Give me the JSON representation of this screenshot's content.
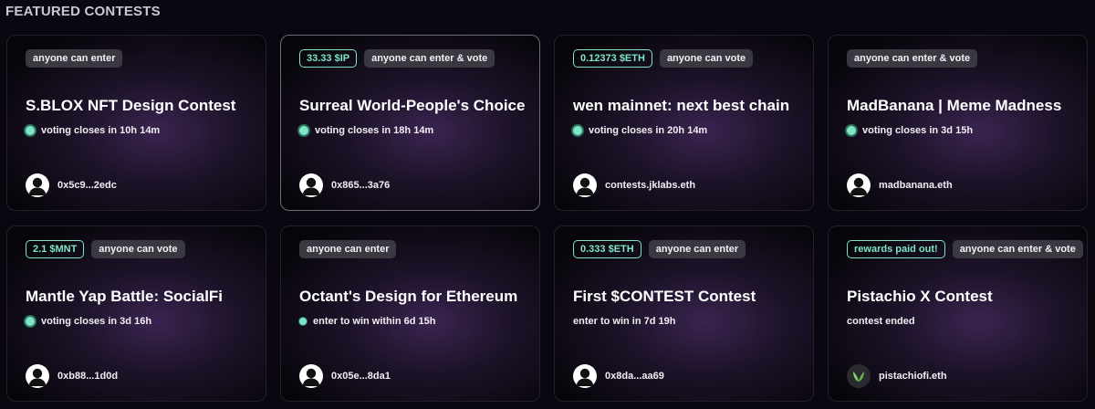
{
  "section_title": "FEATURED CONTESTS",
  "colors": {
    "accent": "#7ee6c4",
    "badge_bg": "#3a3840",
    "card_glow": "#3a2450"
  },
  "contests": [
    {
      "badges": [
        {
          "label": "anyone can enter",
          "kind": "plain"
        }
      ],
      "title": "S.BLOX NFT Design Contest",
      "status": "voting closes in 10h 14m",
      "status_dot": "large",
      "author": "0x5c9...2edc",
      "avatar": "user-avatar-icon"
    },
    {
      "badges": [
        {
          "label": "33.33 $IP",
          "kind": "reward"
        },
        {
          "label": "anyone can enter & vote",
          "kind": "plain"
        }
      ],
      "title": "Surreal World-People's Choice",
      "status": "voting closes in 18h 14m",
      "status_dot": "large",
      "author": "0x865...3a76",
      "avatar": "user-avatar-icon"
    },
    {
      "badges": [
        {
          "label": "0.12373 $ETH",
          "kind": "reward"
        },
        {
          "label": "anyone can vote",
          "kind": "plain"
        }
      ],
      "title": "wen mainnet: next best chain",
      "status": "voting closes in 20h 14m",
      "status_dot": "large",
      "author": "contests.jklabs.eth",
      "avatar": "user-avatar-icon"
    },
    {
      "badges": [
        {
          "label": "anyone can enter & vote",
          "kind": "plain"
        }
      ],
      "title": "MadBanana | Meme Madness",
      "status": "voting closes in 3d 15h",
      "status_dot": "large",
      "author": "madbanana.eth",
      "avatar": "user-avatar-icon"
    },
    {
      "badges": [
        {
          "label": "2.1 $MNT",
          "kind": "reward"
        },
        {
          "label": "anyone can vote",
          "kind": "plain"
        }
      ],
      "title": "Mantle Yap Battle: SocialFi",
      "status": "voting closes in 3d 16h",
      "status_dot": "large",
      "author": "0xb88...1d0d",
      "avatar": "user-avatar-icon"
    },
    {
      "badges": [
        {
          "label": "anyone can enter",
          "kind": "plain"
        }
      ],
      "title": "Octant's Design for Ethereum",
      "status": "enter to win within 6d 15h",
      "status_dot": "small",
      "author": "0x05e...8da1",
      "avatar": "user-avatar-icon"
    },
    {
      "badges": [
        {
          "label": "0.333 $ETH",
          "kind": "reward"
        },
        {
          "label": "anyone can enter",
          "kind": "plain"
        }
      ],
      "title": "First $CONTEST Contest",
      "status": "enter to win in 7d 19h",
      "status_dot": "none",
      "author": "0x8da...aa69",
      "avatar": "user-avatar-icon"
    },
    {
      "badges": [
        {
          "label": "rewards paid out!",
          "kind": "reward"
        },
        {
          "label": "anyone can enter & vote",
          "kind": "plain"
        }
      ],
      "title": "Pistachio X Contest",
      "status": "contest ended",
      "status_dot": "none",
      "author": "pistachiofi.eth",
      "avatar": "pistachio-logo-icon"
    }
  ]
}
